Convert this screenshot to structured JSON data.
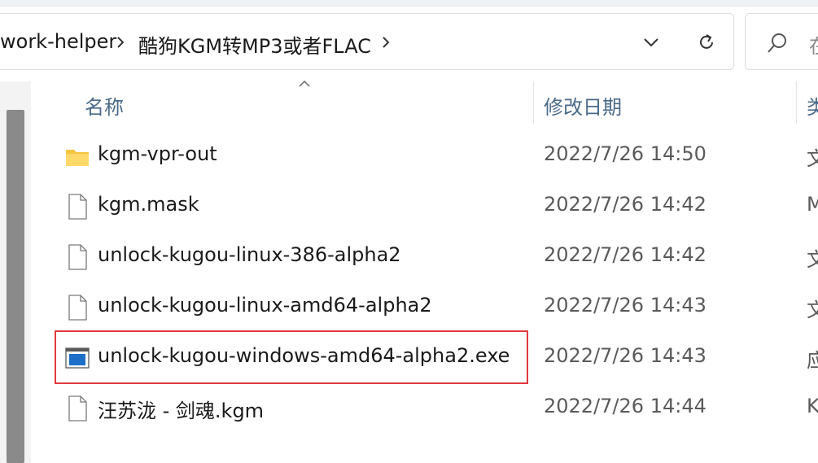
{
  "address_bar": {
    "crumbs": [
      "work-helper",
      "酷狗KGM转MP3或者FLAC"
    ],
    "dropdown_icon": "chevron-down-icon",
    "refresh_icon": "refresh-icon"
  },
  "search": {
    "icon": "search-icon",
    "placeholder_visible": "在"
  },
  "columns": {
    "name": "名称",
    "date": "修改日期",
    "type": "类"
  },
  "files": [
    {
      "name": "kgm-vpr-out",
      "date": "2022/7/26 14:50",
      "type": "文",
      "icon": "folder-icon"
    },
    {
      "name": "kgm.mask",
      "date": "2022/7/26 14:42",
      "type": "M",
      "icon": "file-icon"
    },
    {
      "name": "unlock-kugou-linux-386-alpha2",
      "date": "2022/7/26 14:42",
      "type": "文",
      "icon": "file-icon"
    },
    {
      "name": "unlock-kugou-linux-amd64-alpha2",
      "date": "2022/7/26 14:43",
      "type": "文",
      "icon": "file-icon"
    },
    {
      "name": "unlock-kugou-windows-amd64-alpha2.exe",
      "date": "2022/7/26 14:43",
      "type": "应",
      "icon": "exe-icon",
      "highlighted": true
    },
    {
      "name": "汪苏泷 - 剑魂.kgm",
      "date": "2022/7/26 14:44",
      "type": "K",
      "icon": "file-icon"
    }
  ],
  "colors": {
    "highlight": "#e0393e",
    "header_text": "#4a6a8a",
    "folder": "#f5c542",
    "exe_blue": "#1e6fc8"
  }
}
